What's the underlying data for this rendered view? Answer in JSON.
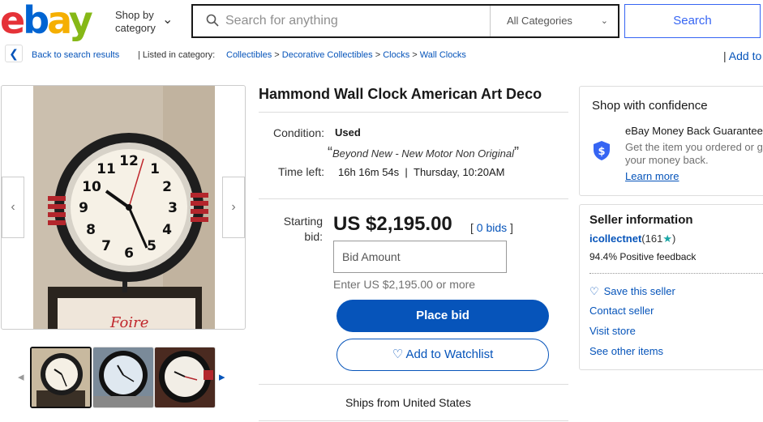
{
  "header": {
    "logo": "ebay",
    "shop_by": "Shop by\ncategory",
    "search_placeholder": "Search for anything",
    "category": "All Categories",
    "search_label": "Search"
  },
  "breadcrumb": {
    "back": "Back to search results",
    "listed_in": "Listed in category:",
    "items": [
      "Collectibles",
      "Decorative Collectibles",
      "Clocks",
      "Wall Clocks"
    ],
    "add_to": "Add to"
  },
  "item": {
    "title": "Hammond Wall Clock American Art Deco",
    "condition_label": "Condition:",
    "condition": "Used",
    "condition_quote": "Beyond New - New Motor Non Original",
    "time_left_label": "Time left:",
    "time_left": "16h 16m 54s",
    "time_end": "Thursday, 10:20AM",
    "starting_bid_label": "Starting\nbid:",
    "price": "US $2,195.00",
    "bids_count": "0 bids",
    "bid_placeholder": "Bid Amount",
    "enter_hint": "Enter US $2,195.00 or more",
    "place_bid": "Place bid",
    "watchlist": "Add to Watchlist",
    "ships_from": "Ships from United States"
  },
  "confidence": {
    "title": "Shop with confidence",
    "guarantee_title": "eBay Money Back Guarantee",
    "guarantee_desc_line1": "Get the item you ordered or get",
    "guarantee_desc_line2": "your money back.",
    "learn_more": "Learn more"
  },
  "seller": {
    "title": "Seller information",
    "name": "icollectnet",
    "feedback_count": "(161",
    "feedback_close": ")",
    "positive": "94.4% Positive feedback",
    "save": "Save this seller",
    "contact": "Contact seller",
    "visit": "Visit store",
    "other": "See other items"
  },
  "colors": {
    "link": "#0654ba",
    "primary_button": "#0654ba",
    "search_button_text": "#3665f3"
  },
  "icons": {
    "search": "magnifier-icon",
    "chevron_down": "chevron-down-icon",
    "back": "chevron-left-icon",
    "shield": "shield-dollar-icon",
    "heart": "heart-icon",
    "star": "star-icon"
  }
}
